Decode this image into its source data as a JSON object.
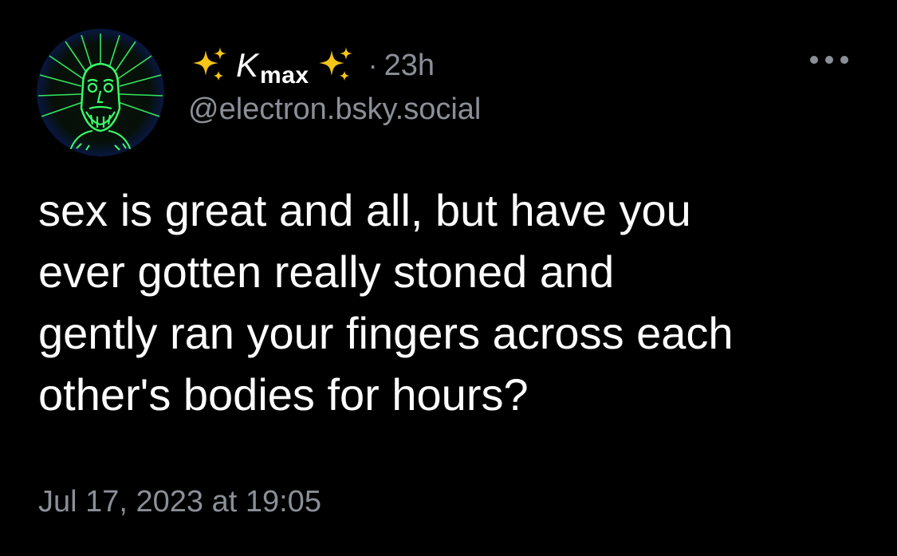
{
  "post": {
    "author": {
      "display_name_prefix": "✨",
      "display_name_main": "K",
      "display_name_sub": "max",
      "display_name_suffix": "✨",
      "handle": "@electron.bsky.social",
      "avatar_icon": "neon-green-face-sun-drawing-icon"
    },
    "separator": "·",
    "relative_time": "23h",
    "text_lines": [
      "sex is great and all, but have you",
      "ever gotten really stoned and",
      "gently ran your fingers across each",
      "other's bodies for hours?"
    ],
    "timestamp": "Jul 17, 2023 at 19:05",
    "more_icon": "more-options-icon"
  },
  "colors": {
    "background": "#000000",
    "text_primary": "#ffffff",
    "text_secondary": "#8b8f97",
    "sparkle": "#f5c518",
    "avatar_accent": "#39ff6a",
    "avatar_ring": "#1d3fa6"
  }
}
